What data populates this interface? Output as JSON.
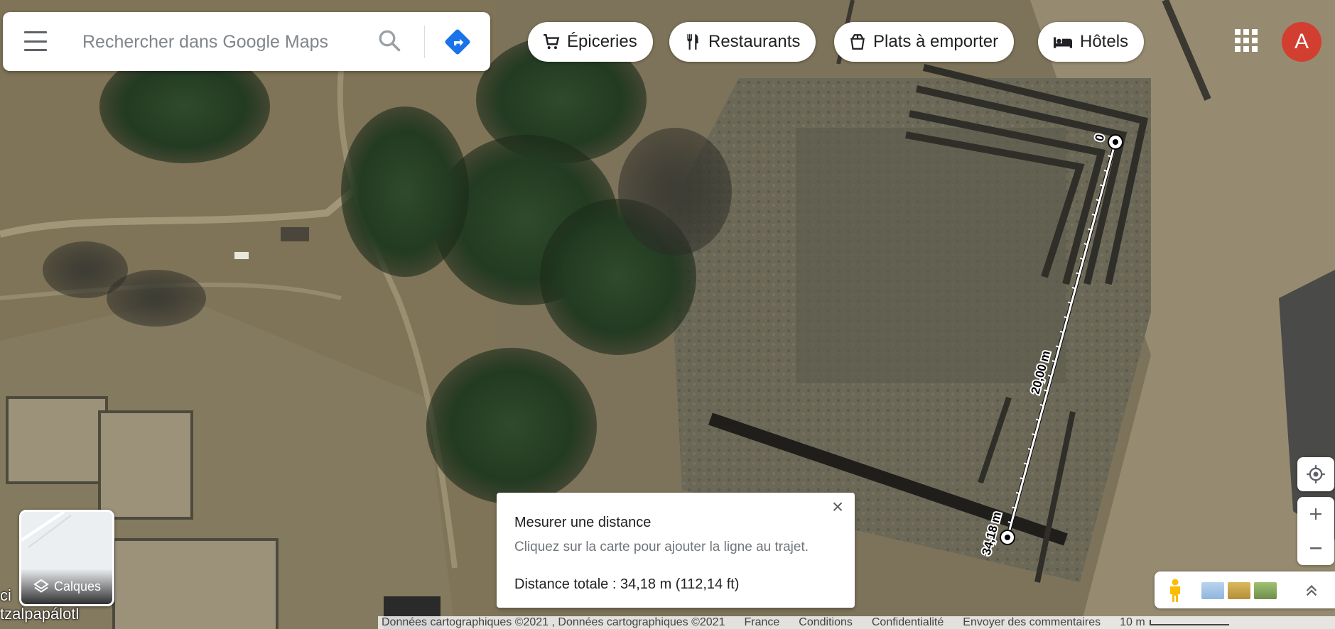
{
  "search": {
    "placeholder": "Rechercher dans Google Maps"
  },
  "chips": [
    {
      "label": "Épiceries",
      "icon": "shopping-cart-icon"
    },
    {
      "label": "Restaurants",
      "icon": "fork-knife-icon"
    },
    {
      "label": "Plats à emporter",
      "icon": "takeout-icon"
    },
    {
      "label": "Hôtels",
      "icon": "bed-icon"
    }
  ],
  "account": {
    "initial": "A",
    "color": "#d23f31"
  },
  "measure": {
    "title": "Mesurer une distance",
    "hint": "Cliquez sur la carte pour ajouter la ligne au trajet.",
    "total": "Distance totale : 34,18 m (112,14 ft)",
    "start_label": "0",
    "mid_label": "20,00 m",
    "end_label": "34,18 m"
  },
  "layers": {
    "label": "Calques"
  },
  "place_labels": [
    "ci",
    "tzalpapálotl"
  ],
  "footer": {
    "items": [
      "Données cartographiques ©2021 , Données cartographiques ©2021",
      "France",
      "Conditions",
      "Confidentialité",
      "Envoyer des commentaires"
    ],
    "scale": "10 m"
  },
  "colors": {
    "accent": "#1a73e8",
    "avatar": "#d23f31"
  }
}
